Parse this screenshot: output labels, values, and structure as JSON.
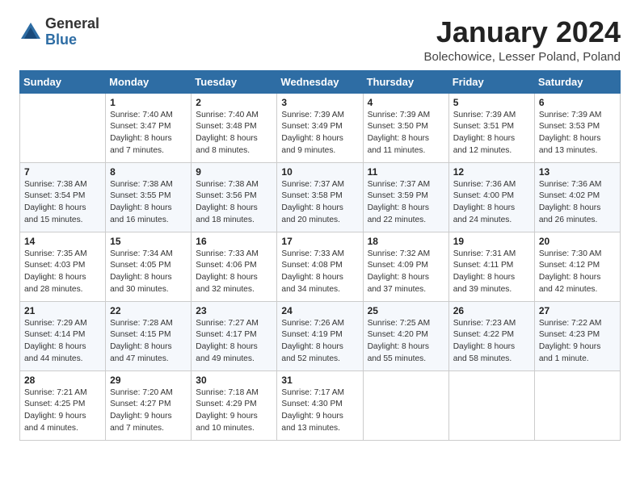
{
  "logo": {
    "general": "General",
    "blue": "Blue"
  },
  "title": "January 2024",
  "subtitle": "Bolechowice, Lesser Poland, Poland",
  "days_header": [
    "Sunday",
    "Monday",
    "Tuesday",
    "Wednesday",
    "Thursday",
    "Friday",
    "Saturday"
  ],
  "weeks": [
    [
      {
        "day": "",
        "info": ""
      },
      {
        "day": "1",
        "info": "Sunrise: 7:40 AM\nSunset: 3:47 PM\nDaylight: 8 hours\nand 7 minutes."
      },
      {
        "day": "2",
        "info": "Sunrise: 7:40 AM\nSunset: 3:48 PM\nDaylight: 8 hours\nand 8 minutes."
      },
      {
        "day": "3",
        "info": "Sunrise: 7:39 AM\nSunset: 3:49 PM\nDaylight: 8 hours\nand 9 minutes."
      },
      {
        "day": "4",
        "info": "Sunrise: 7:39 AM\nSunset: 3:50 PM\nDaylight: 8 hours\nand 11 minutes."
      },
      {
        "day": "5",
        "info": "Sunrise: 7:39 AM\nSunset: 3:51 PM\nDaylight: 8 hours\nand 12 minutes."
      },
      {
        "day": "6",
        "info": "Sunrise: 7:39 AM\nSunset: 3:53 PM\nDaylight: 8 hours\nand 13 minutes."
      }
    ],
    [
      {
        "day": "7",
        "info": "Sunrise: 7:38 AM\nSunset: 3:54 PM\nDaylight: 8 hours\nand 15 minutes."
      },
      {
        "day": "8",
        "info": "Sunrise: 7:38 AM\nSunset: 3:55 PM\nDaylight: 8 hours\nand 16 minutes."
      },
      {
        "day": "9",
        "info": "Sunrise: 7:38 AM\nSunset: 3:56 PM\nDaylight: 8 hours\nand 18 minutes."
      },
      {
        "day": "10",
        "info": "Sunrise: 7:37 AM\nSunset: 3:58 PM\nDaylight: 8 hours\nand 20 minutes."
      },
      {
        "day": "11",
        "info": "Sunrise: 7:37 AM\nSunset: 3:59 PM\nDaylight: 8 hours\nand 22 minutes."
      },
      {
        "day": "12",
        "info": "Sunrise: 7:36 AM\nSunset: 4:00 PM\nDaylight: 8 hours\nand 24 minutes."
      },
      {
        "day": "13",
        "info": "Sunrise: 7:36 AM\nSunset: 4:02 PM\nDaylight: 8 hours\nand 26 minutes."
      }
    ],
    [
      {
        "day": "14",
        "info": "Sunrise: 7:35 AM\nSunset: 4:03 PM\nDaylight: 8 hours\nand 28 minutes."
      },
      {
        "day": "15",
        "info": "Sunrise: 7:34 AM\nSunset: 4:05 PM\nDaylight: 8 hours\nand 30 minutes."
      },
      {
        "day": "16",
        "info": "Sunrise: 7:33 AM\nSunset: 4:06 PM\nDaylight: 8 hours\nand 32 minutes."
      },
      {
        "day": "17",
        "info": "Sunrise: 7:33 AM\nSunset: 4:08 PM\nDaylight: 8 hours\nand 34 minutes."
      },
      {
        "day": "18",
        "info": "Sunrise: 7:32 AM\nSunset: 4:09 PM\nDaylight: 8 hours\nand 37 minutes."
      },
      {
        "day": "19",
        "info": "Sunrise: 7:31 AM\nSunset: 4:11 PM\nDaylight: 8 hours\nand 39 minutes."
      },
      {
        "day": "20",
        "info": "Sunrise: 7:30 AM\nSunset: 4:12 PM\nDaylight: 8 hours\nand 42 minutes."
      }
    ],
    [
      {
        "day": "21",
        "info": "Sunrise: 7:29 AM\nSunset: 4:14 PM\nDaylight: 8 hours\nand 44 minutes."
      },
      {
        "day": "22",
        "info": "Sunrise: 7:28 AM\nSunset: 4:15 PM\nDaylight: 8 hours\nand 47 minutes."
      },
      {
        "day": "23",
        "info": "Sunrise: 7:27 AM\nSunset: 4:17 PM\nDaylight: 8 hours\nand 49 minutes."
      },
      {
        "day": "24",
        "info": "Sunrise: 7:26 AM\nSunset: 4:19 PM\nDaylight: 8 hours\nand 52 minutes."
      },
      {
        "day": "25",
        "info": "Sunrise: 7:25 AM\nSunset: 4:20 PM\nDaylight: 8 hours\nand 55 minutes."
      },
      {
        "day": "26",
        "info": "Sunrise: 7:23 AM\nSunset: 4:22 PM\nDaylight: 8 hours\nand 58 minutes."
      },
      {
        "day": "27",
        "info": "Sunrise: 7:22 AM\nSunset: 4:23 PM\nDaylight: 9 hours\nand 1 minute."
      }
    ],
    [
      {
        "day": "28",
        "info": "Sunrise: 7:21 AM\nSunset: 4:25 PM\nDaylight: 9 hours\nand 4 minutes."
      },
      {
        "day": "29",
        "info": "Sunrise: 7:20 AM\nSunset: 4:27 PM\nDaylight: 9 hours\nand 7 minutes."
      },
      {
        "day": "30",
        "info": "Sunrise: 7:18 AM\nSunset: 4:29 PM\nDaylight: 9 hours\nand 10 minutes."
      },
      {
        "day": "31",
        "info": "Sunrise: 7:17 AM\nSunset: 4:30 PM\nDaylight: 9 hours\nand 13 minutes."
      },
      {
        "day": "",
        "info": ""
      },
      {
        "day": "",
        "info": ""
      },
      {
        "day": "",
        "info": ""
      }
    ]
  ]
}
